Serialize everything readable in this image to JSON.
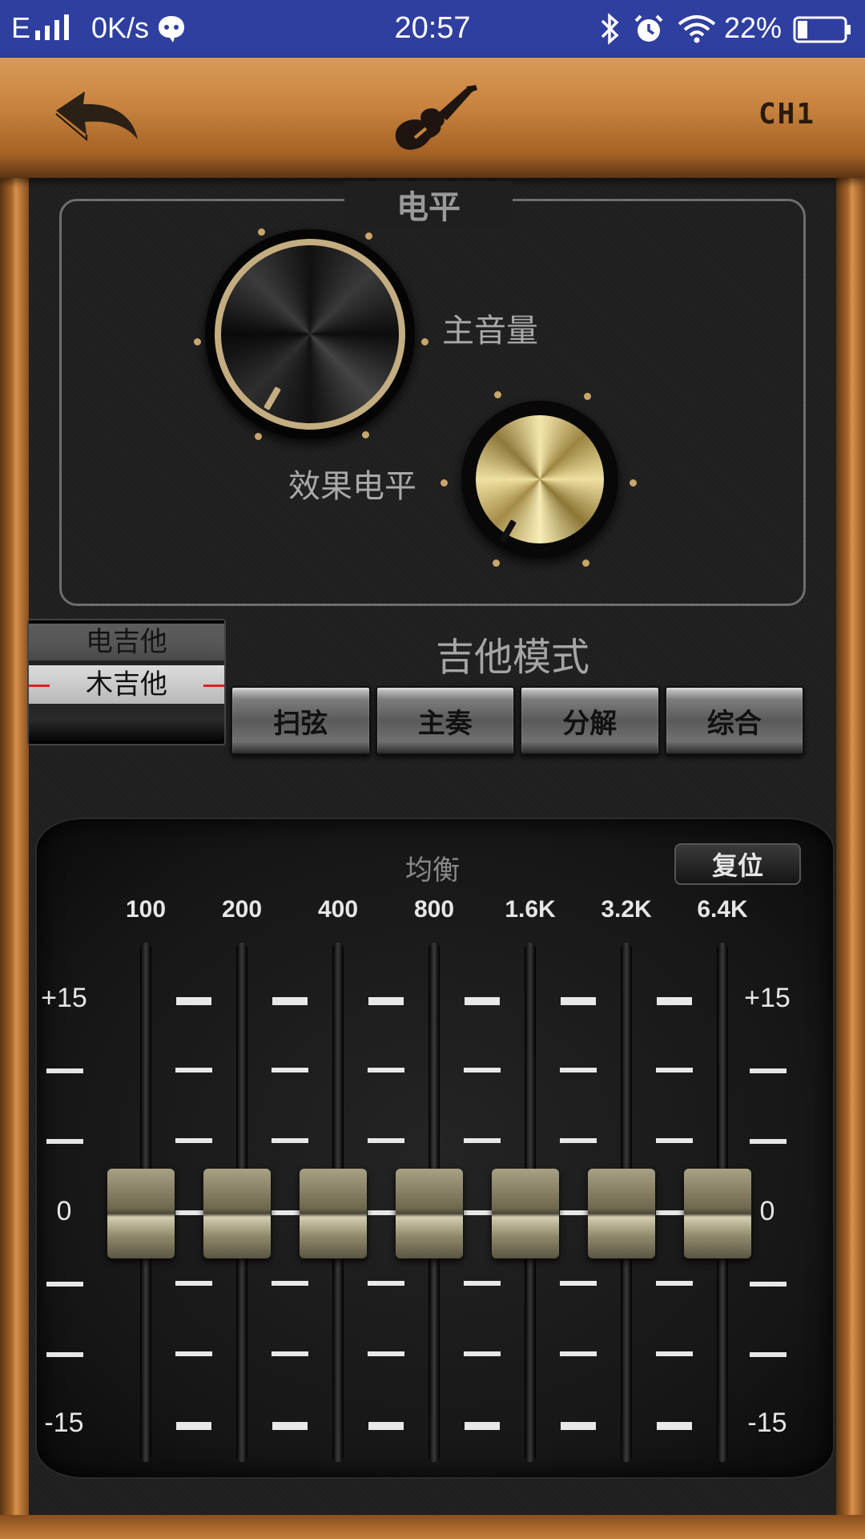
{
  "status_bar": {
    "carrier": "E",
    "speed": "0K/s",
    "time": "20:57",
    "battery_pct": "22%",
    "icons": [
      "signal-icon",
      "chat-bubble-icon",
      "bluetooth-icon",
      "alarm-icon",
      "wifi-icon",
      "battery-icon"
    ]
  },
  "header": {
    "channel": "CH1",
    "icons": [
      "back-arrow-icon",
      "electric-guitar-icon"
    ]
  },
  "level_section": {
    "title": "电平",
    "master_label": "主音量",
    "effect_label": "效果电平"
  },
  "guitar_type": {
    "options": [
      "电吉他",
      "木吉他"
    ],
    "selected": "木吉他"
  },
  "guitar_mode": {
    "title": "吉他模式",
    "buttons": [
      "扫弦",
      "主奏",
      "分解",
      "综合"
    ]
  },
  "eq": {
    "title": "均衡",
    "reset_label": "复位",
    "frequencies": [
      "100",
      "200",
      "400",
      "800",
      "1.6K",
      "3.2K",
      "6.4K"
    ],
    "scale_top": "+15",
    "scale_mid": "0",
    "scale_bottom": "-15",
    "gains_db": [
      0,
      0,
      0,
      0,
      0,
      0,
      0
    ]
  },
  "colors": {
    "status_bar": "#2f3f9f",
    "wood": "#c8843f",
    "gold_knob": "#efe0a0"
  }
}
